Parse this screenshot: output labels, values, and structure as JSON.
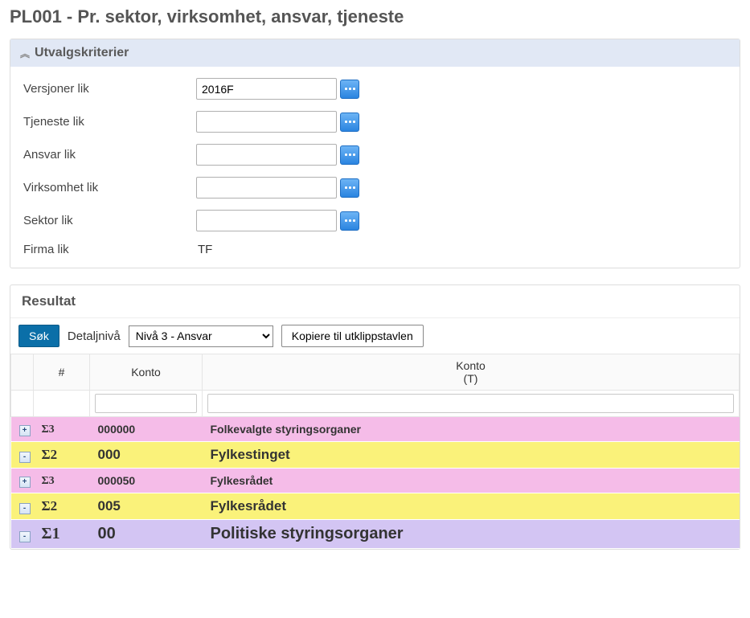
{
  "page_title": "PL001 - Pr. sektor, virksomhet, ansvar, tjeneste",
  "criteria_panel": {
    "title": "Utvalgskriterier",
    "rows": {
      "versjoner": {
        "label": "Versjoner lik",
        "value": "2016F"
      },
      "tjeneste": {
        "label": "Tjeneste lik",
        "value": ""
      },
      "ansvar": {
        "label": "Ansvar lik",
        "value": ""
      },
      "virksomhet": {
        "label": "Virksomhet lik",
        "value": ""
      },
      "sektor": {
        "label": "Sektor lik",
        "value": ""
      },
      "firma": {
        "label": "Firma lik",
        "value": "TF"
      }
    }
  },
  "result_panel": {
    "title": "Resultat",
    "search_btn": "Søk",
    "detail_label": "Detaljnivå",
    "detail_value": "Nivå 3 - Ansvar",
    "copy_btn": "Kopiere til utklippstavlen",
    "columns": {
      "num": "#",
      "konto": "Konto",
      "konto_t_line1": "Konto",
      "konto_t_line2": "(T)"
    },
    "rows": [
      {
        "level": 3,
        "sigma": "Σ3",
        "expand": "+",
        "row_style": "pink",
        "konto": "000000",
        "text": "Folkevalgte styringsorganer"
      },
      {
        "level": 2,
        "sigma": "Σ2",
        "expand": "-",
        "row_style": "yellow",
        "konto": "000",
        "text": "Fylkestinget"
      },
      {
        "level": 3,
        "sigma": "Σ3",
        "expand": "+",
        "row_style": "pink",
        "konto": "000050",
        "text": "Fylkesrådet"
      },
      {
        "level": 2,
        "sigma": "Σ2",
        "expand": "-",
        "row_style": "yellow",
        "konto": "005",
        "text": "Fylkesrådet"
      },
      {
        "level": 1,
        "sigma": "Σ1",
        "expand": "-",
        "row_style": "lavender",
        "konto": "00",
        "text": "Politiske styringsorganer"
      }
    ]
  }
}
